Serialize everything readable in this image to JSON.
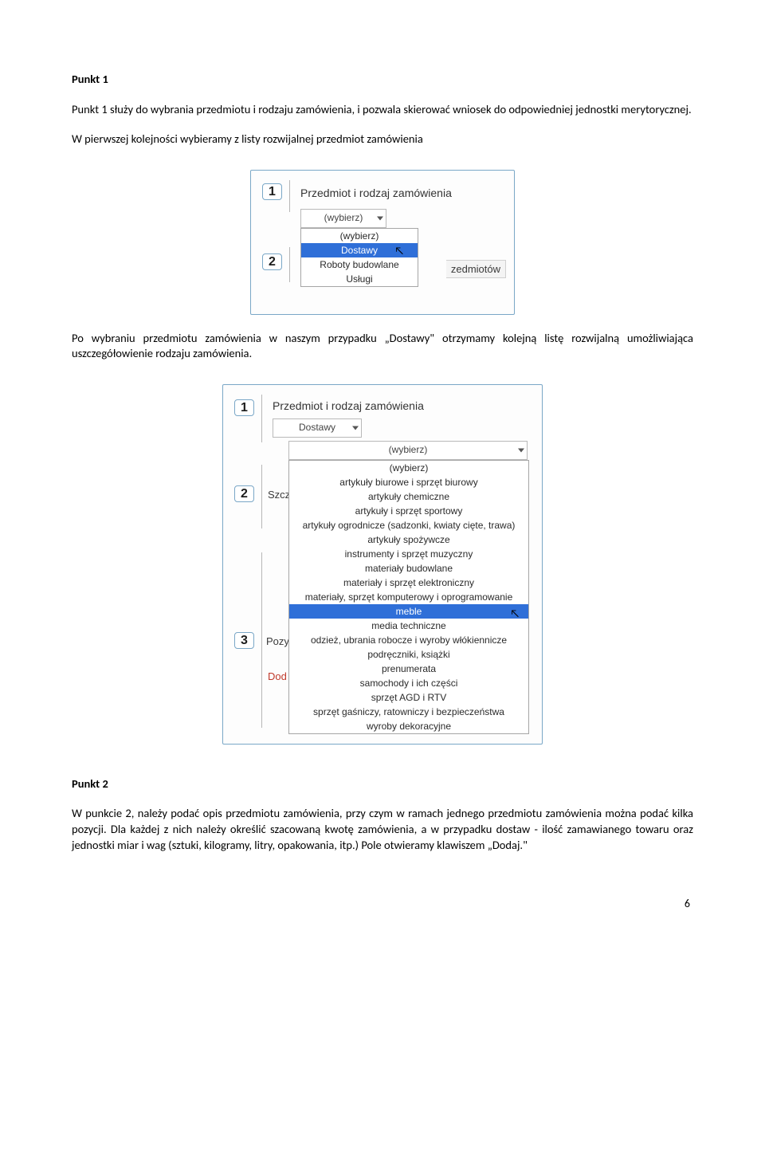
{
  "heading1": "Punkt 1",
  "para1": "Punkt 1 służy do wybrania przedmiotu i rodzaju  zamówienia, i pozwala skierować wniosek do odpowiedniej jednostki merytorycznej.",
  "para2": "W pierwszej kolejności wybieramy z listy rozwijalnej przedmiot zamówienia",
  "shot1": {
    "title": "Przedmiot i rodzaj zamówienia",
    "num1": "1",
    "num2": "2",
    "sel_value": "(wybierz)",
    "options": [
      "(wybierz)",
      "Dostawy",
      "Roboty budowlane",
      "Usługi"
    ],
    "truncated_tab": "zedmiotów"
  },
  "para3": "Po wybraniu przedmiotu zamówienia w naszym przypadku „Dostawy\" otrzymamy kolejną listę rozwijalną umożliwiająca uszczegółowienie rodzaju zamówienia.",
  "shot2": {
    "title": "Przedmiot i rodzaj zamówienia",
    "num1": "1",
    "num2": "2",
    "num3": "3",
    "sel_value": "Dostawy",
    "sub_sel_value": "(wybierz)",
    "szcz": "Szcz",
    "pozy": "Pozy",
    "dod": "Dod",
    "options": [
      "(wybierz)",
      "artykuły biurowe i sprzęt biurowy",
      "artykuły chemiczne",
      "artykuły i sprzęt sportowy",
      "artykuły ogrodnicze (sadzonki, kwiaty cięte, trawa)",
      "artykuły spożywcze",
      "instrumenty i sprzęt muzyczny",
      "materiały budowlane",
      "materiały i sprzęt elektroniczny",
      "materiały, sprzęt komputerowy i oprogramowanie",
      "meble",
      "media techniczne",
      "odzież, ubrania robocze i wyroby włókiennicze",
      "podręczniki, książki",
      "prenumerata",
      "samochody i ich części",
      "sprzęt AGD i RTV",
      "sprzęt gaśniczy, ratowniczy i bezpieczeństwa",
      "wyroby dekoracyjne"
    ]
  },
  "heading2": "Punkt 2",
  "para4": "W punkcie 2, należy podać opis przedmiotu zamówienia, przy czym w ramach jednego przedmiotu zamówienia można podać kilka pozycji. Dla każdej z nich należy określić szacowaną kwotę zamówienia, a w przypadku dostaw - ilość zamawianego towaru oraz jednostki miar i wag (sztuki, kilogramy, litry, opakowania, itp.) Pole otwieramy klawiszem „Dodaj.\"",
  "page_number": "6"
}
